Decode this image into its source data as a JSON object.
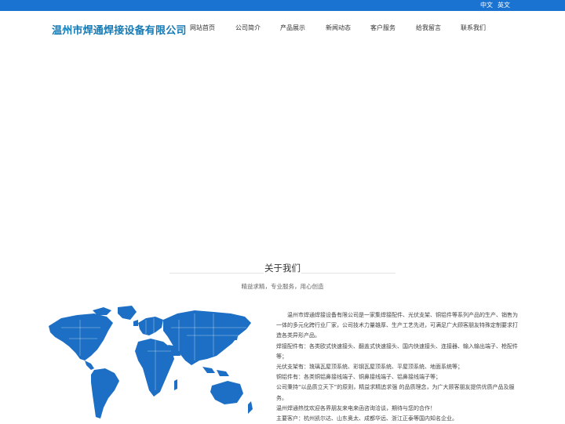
{
  "topbar": {
    "lang_zh": "中文",
    "lang_en": "英文"
  },
  "header": {
    "logo": "温州市焊通焊接设备有限公司",
    "nav": [
      "网站首页",
      "公司简介",
      "产品展示",
      "新闻动态",
      "客户服务",
      "给我留言",
      "联系我们"
    ]
  },
  "about": {
    "title": "关于我们",
    "subtitle": "精益求精，专业服务，用心创造",
    "paragraphs": [
      "温州市焊通焊接设备有限公司是一家集焊接配件、光伏支架、铜铝件等系列产品的生产、销售为一体的多元化跨行业厂家，公司技术力量雄厚、生产工艺先进，可满足广大顾客朋友特殊定制要求打造各类异形产品。",
      "焊接配件有：各类欧式快速接头、翻盖式快速接头、国内快速接头、连接器、输入输出端子、枪配件等；",
      "光伏支架有：琉璃瓦屋顶系统、彩钢瓦屋顶系统、平屋顶系统、地面系统等；",
      "铜铝件有：各类铜铝鼻接线端子、铜鼻接线端子、铝鼻接线端子等；",
      "公司秉持“以品质立天下”的原则，精益求精追求强 的品质理念，为广大顾客朋友提供优质产品及服务。",
      "温州焊通热忱欢迎各界朋友来电来函咨询洽谈，期待与您的合作！",
      "主要客户：杭州凯尔达、山东奥太、成都华远、浙江正泰等国内知名企业。"
    ]
  },
  "colors": {
    "topbar": "#1a72d1",
    "logo": "#157ab3",
    "map": "#1c6fc4"
  }
}
